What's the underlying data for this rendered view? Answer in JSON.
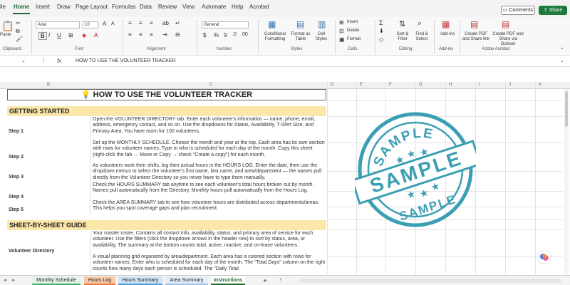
{
  "menu": {
    "items": [
      "ile",
      "Home",
      "Insert",
      "Draw",
      "Page Layout",
      "Formulas",
      "Data",
      "Review",
      "View",
      "Automate",
      "Help",
      "Acrobat"
    ],
    "comments_label": "Comments",
    "share_label": "Share"
  },
  "ribbon": {
    "font_name": "Arial",
    "font_size": "10",
    "number_format": "General",
    "paste_label": "Paste",
    "bold": "B",
    "italic": "I",
    "underline": "U",
    "cond_format": "Conditional Formatting",
    "format_table": "Format as Table",
    "cell_styles": "Cell Styles",
    "insert": "Insert",
    "delete": "Delete",
    "format": "Format",
    "sort_filter": "Sort & Filter",
    "find_select": "Find & Select",
    "addins": "Add-ins",
    "create_pdf": "Create PDF and Share link",
    "create_pdf2": "Create PDF and Share via Outlook",
    "groups": [
      "Clipboard",
      "Font",
      "Alignment",
      "Number",
      "Styles",
      "Cells",
      "Editing",
      "Add-ins",
      "Adobe Acrobat"
    ],
    "currency": "$",
    "percent": "%",
    "comma": "9"
  },
  "formula_bar": {
    "fx": "fx",
    "content": "HOW TO USE THE VOLUNTEER TRACKER"
  },
  "columns": [
    "B",
    "C",
    "D",
    "E",
    "F",
    "G",
    "H",
    "I",
    "J",
    "K"
  ],
  "sheet": {
    "title": "HOW TO USE THE VOLUNTEER TRACKER",
    "getting_started": "GETTING STARTED",
    "steps": [
      {
        "label": "Step 1",
        "text": "Open the VOLUNTEER DIRECTORY tab. Enter each volunteer's information — name, phone, email, address, emergency contact, and so on. Use the dropdowns for Status, Availability, T-Shirt Size, and Primary Area. You have room for 100 volunteers."
      },
      {
        "label": "Step 2",
        "text": "Set up the MONTHLY SCHEDULE. Choose the month and year at the top. Each area has its own section with rows for volunteer names. Type in who is scheduled for each day of the month. Copy this sheet (right-click the tab → Move or Copy → check \"Create a copy\") for each month."
      },
      {
        "label": "Step 3",
        "text": "As volunteers work their shifts, log their actual hours in the HOURS LOG. Enter the date, then use the dropdown menus to select the volunteer's first name, last name, and area/department — the names pull directly from the Volunteer Directory so you never have to type them manually."
      },
      {
        "label": "Step 4",
        "text": "Check the HOURS SUMMARY tab anytime to see each volunteer's total hours broken out by month. Names pull automatically from the Directory. Monthly hours pull automatically from the Hours Log."
      },
      {
        "label": "Step 5",
        "text": "Check the AREA SUMMARY tab to see how volunteer hours are distributed across departments/areas. This helps you spot coverage gaps and plan recruitment."
      }
    ],
    "sheet_guide": "SHEET-BY-SHEET GUIDE",
    "guide": [
      {
        "label": "Volunteer Directory",
        "text": "Your master roster. Contains all contact info, availability, status, and primary area of service for each volunteer. Use the filters (click the dropdown arrows in the header row) to sort by status, area, or availability. The summary at the bottom counts total, active, inactive, and on-leave volunteers."
      },
      {
        "label": "",
        "text": "A visual planning grid organized by area/department. Each area has a colored section with rows for volunteer names. Enter who is scheduled for each day of the month. The \"Total Days\" column on the right counts how many days each person is scheduled. The \"Daily Total"
      }
    ]
  },
  "stamp": {
    "top_text": "SAMPLE",
    "center_text": "SAMPLE",
    "bottom_text": "SAMPLE",
    "color": "#3b9fb3"
  },
  "tabs": [
    {
      "label": "Monthly Schedule",
      "color": "#3fae6a"
    },
    {
      "label": "Hours Log",
      "color": "#e8763a"
    },
    {
      "label": "Hours Summary",
      "color": "#4f9ad6"
    },
    {
      "label": "Area Summary",
      "color": "#9cc3e6"
    },
    {
      "label": "Instructions",
      "color": "#ffffff"
    }
  ],
  "tab_add": "+",
  "tab_more": "⋮"
}
